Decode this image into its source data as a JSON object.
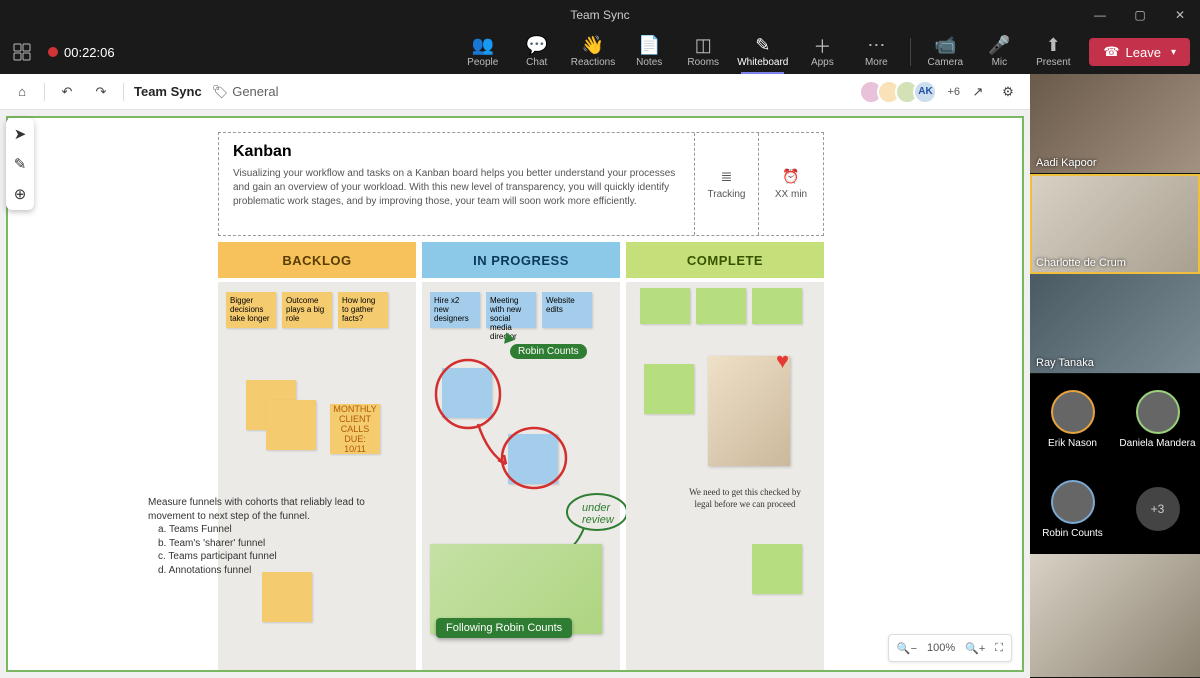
{
  "window": {
    "title": "Team Sync"
  },
  "toolbar": {
    "recording_time": "00:22:06",
    "buttons": {
      "people": "People",
      "chat": "Chat",
      "reactions": "Reactions",
      "notes": "Notes",
      "rooms": "Rooms",
      "whiteboard": "Whiteboard",
      "apps": "Apps",
      "more": "More",
      "camera": "Camera",
      "mic": "Mic",
      "present": "Present"
    },
    "leave": "Leave"
  },
  "wbheader": {
    "title": "Team Sync",
    "channel": "General",
    "more_count": "+6"
  },
  "kanban": {
    "title": "Kanban",
    "desc": "Visualizing your workflow and tasks on a Kanban board helps you better understand your processes and gain an overview of your workload. With this new level of transparency, you will quickly identify problematic work stages, and by improving those, your team will soon work more efficiently.",
    "meta1": "Tracking",
    "meta2": "XX min"
  },
  "columns": {
    "backlog": "BACKLOG",
    "progress": "IN PROGRESS",
    "complete": "COMPLETE"
  },
  "notes": {
    "b1": "Bigger decisions take longer",
    "b2": "Outcome plays a big role",
    "b3": "How long to gather facts?",
    "p1": "Hire x2 new designers",
    "p2": "Meeting with new social media director",
    "p3": "Website edits",
    "monthly": "MONTHLY CLIENT CALLS",
    "monthly_due": "DUE: 10/11"
  },
  "text": {
    "funnel": "Measure funnels with cohorts that reliably lead to movement to next step of the funnel.",
    "funnel_a": "a. Teams Funnel",
    "funnel_b": "b. Team's 'sharer' funnel",
    "funnel_c": "c. Teams participant funnel",
    "funnel_d": "d. Annotations funnel",
    "legal": "We need to get this checked by legal before we can proceed",
    "under_review": "under review",
    "cursor_name": "Robin Counts",
    "following": "Following Robin Counts"
  },
  "zoom": {
    "level": "100%"
  },
  "participants": {
    "p1": "Aadi Kapoor",
    "p2": "Charlotte de Crum",
    "p3": "Ray Tanaka",
    "m1": "Erik Nason",
    "m2": "Daniela Mandera",
    "m3": "Robin Counts",
    "m4_plus": "+3"
  }
}
